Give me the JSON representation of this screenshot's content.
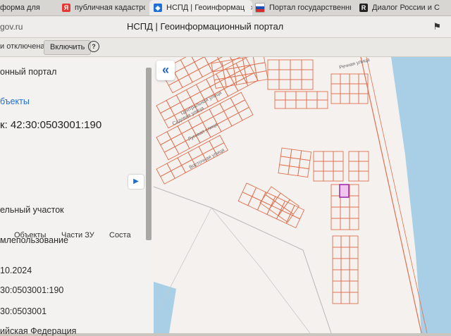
{
  "browser": {
    "tabs": [
      {
        "label": "форма для",
        "icon": "generic-favicon",
        "color": "#9a9a9a"
      },
      {
        "label": "публичная кадастровая",
        "icon": "yandex-favicon",
        "color": "#e53935"
      },
      {
        "label": "НСПД | Геоинформац",
        "icon": "nspd-favicon",
        "color": "#1d6fd6",
        "close": "×"
      },
      {
        "label": "Портал государственны",
        "icon": "russia-flag-favicon",
        "color": "#d32f2f"
      },
      {
        "label": "Диалог России и С",
        "icon": "dialog-favicon",
        "color": "#222222"
      }
    ],
    "url": "gov.ru",
    "page_title": "НСПД | Геоинформационный портал",
    "bookmark_icon": "bookmark-icon"
  },
  "infobar": {
    "text": "и отключена",
    "button": "Включить",
    "help": "?"
  },
  "panel": {
    "portal_title": "онный портал",
    "objects_link": "бъекты",
    "cadastral_label": "к: 42:30:0503001:190",
    "tabs": [
      "Объекты",
      "Части ЗУ",
      "Соста"
    ],
    "rows": [
      "ельный участок",
      "млепользование",
      "10.2024",
      "30:0503001:190",
      "30:0503001",
      "ийская Федерация"
    ]
  },
  "map": {
    "streets": [
      "Центральная улица",
      "Садовая улица",
      "Луговая улица",
      "Восточная улица",
      "Речная улица"
    ],
    "parcel_color": "#e0704f",
    "selected_color": "#a030b0",
    "water_color": "#a9cfe6",
    "collapse_icon": "chevron-double-left-icon"
  }
}
